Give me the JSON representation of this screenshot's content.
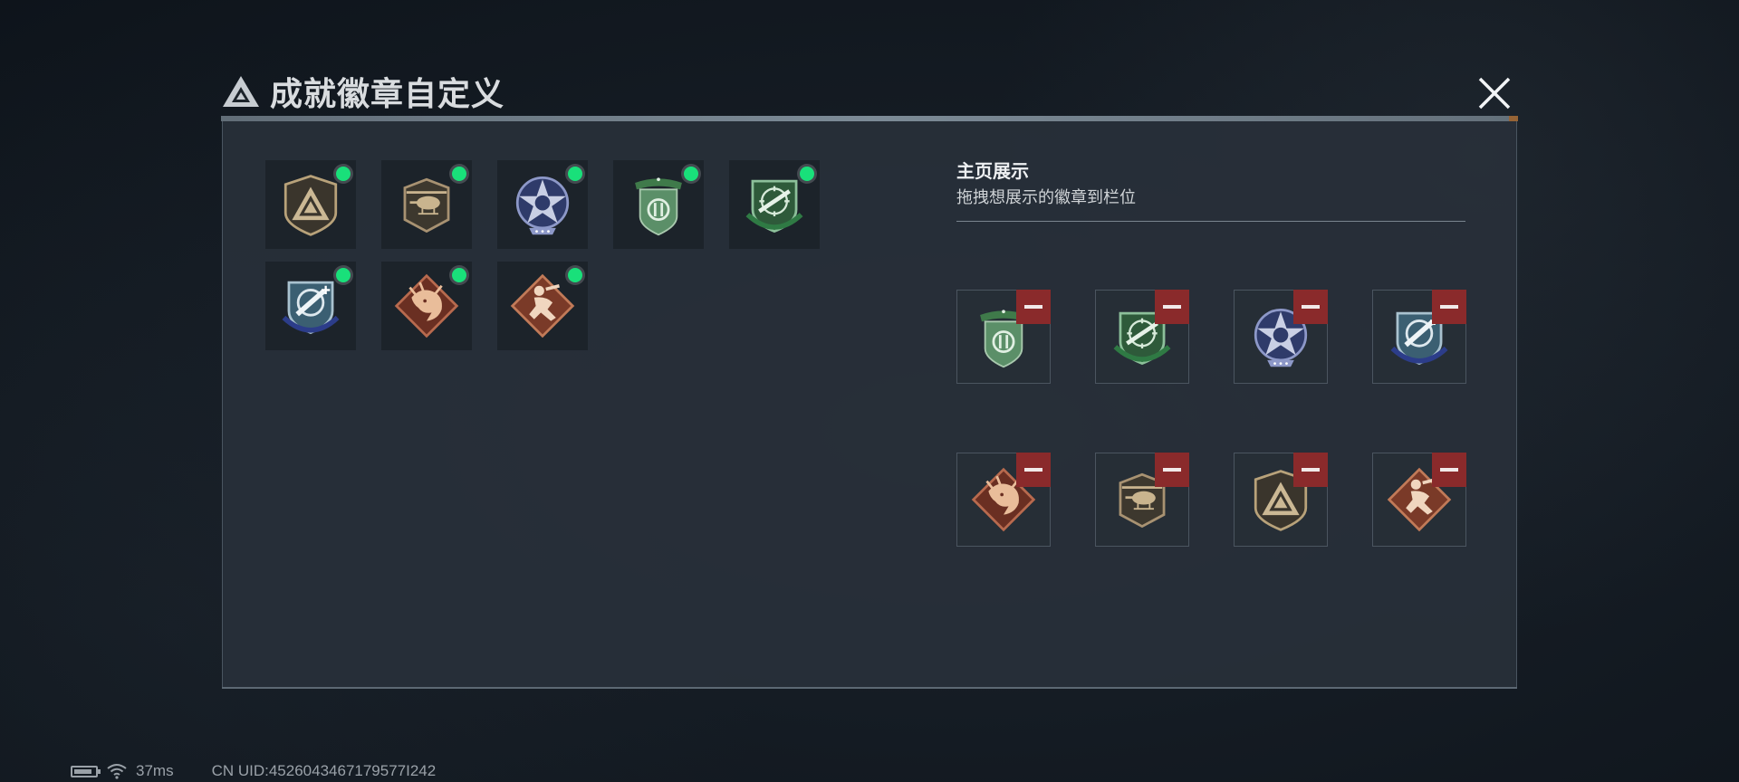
{
  "header": {
    "title": "成就徽章自定义",
    "close_icon": "close-icon",
    "accent_color": "#c07a3a"
  },
  "inventory": {
    "items": [
      {
        "badge": "triangle-shield-badge",
        "equipped": true
      },
      {
        "badge": "helicopter-badge",
        "equipped": true
      },
      {
        "badge": "star-skull-badge",
        "equipped": true
      },
      {
        "badge": "green-shield-badge",
        "equipped": true
      },
      {
        "badge": "rifle-crosshair-badge",
        "equipped": true
      },
      {
        "badge": "blue-rocket-badge",
        "equipped": true
      },
      {
        "badge": "dragon-diamond-badge",
        "equipped": true
      },
      {
        "badge": "runner-diamond-badge",
        "equipped": true
      }
    ],
    "equipped_dot_color": "#19e07a"
  },
  "showcase": {
    "title": "主页展示",
    "subtitle": "拖拽想展示的徽章到栏位",
    "slots": [
      {
        "badge": "green-shield-badge"
      },
      {
        "badge": "rifle-crosshair-badge"
      },
      {
        "badge": "star-skull-badge"
      },
      {
        "badge": "blue-rocket-badge"
      },
      {
        "badge": "dragon-diamond-badge"
      },
      {
        "badge": "helicopter-badge"
      },
      {
        "badge": "triangle-shield-badge"
      },
      {
        "badge": "runner-diamond-badge"
      }
    ],
    "remove_icon": "minus-icon",
    "remove_color": "#8a2a2b"
  },
  "status": {
    "ping": "37ms",
    "uid": "CN UID:4526043467179577I242"
  }
}
